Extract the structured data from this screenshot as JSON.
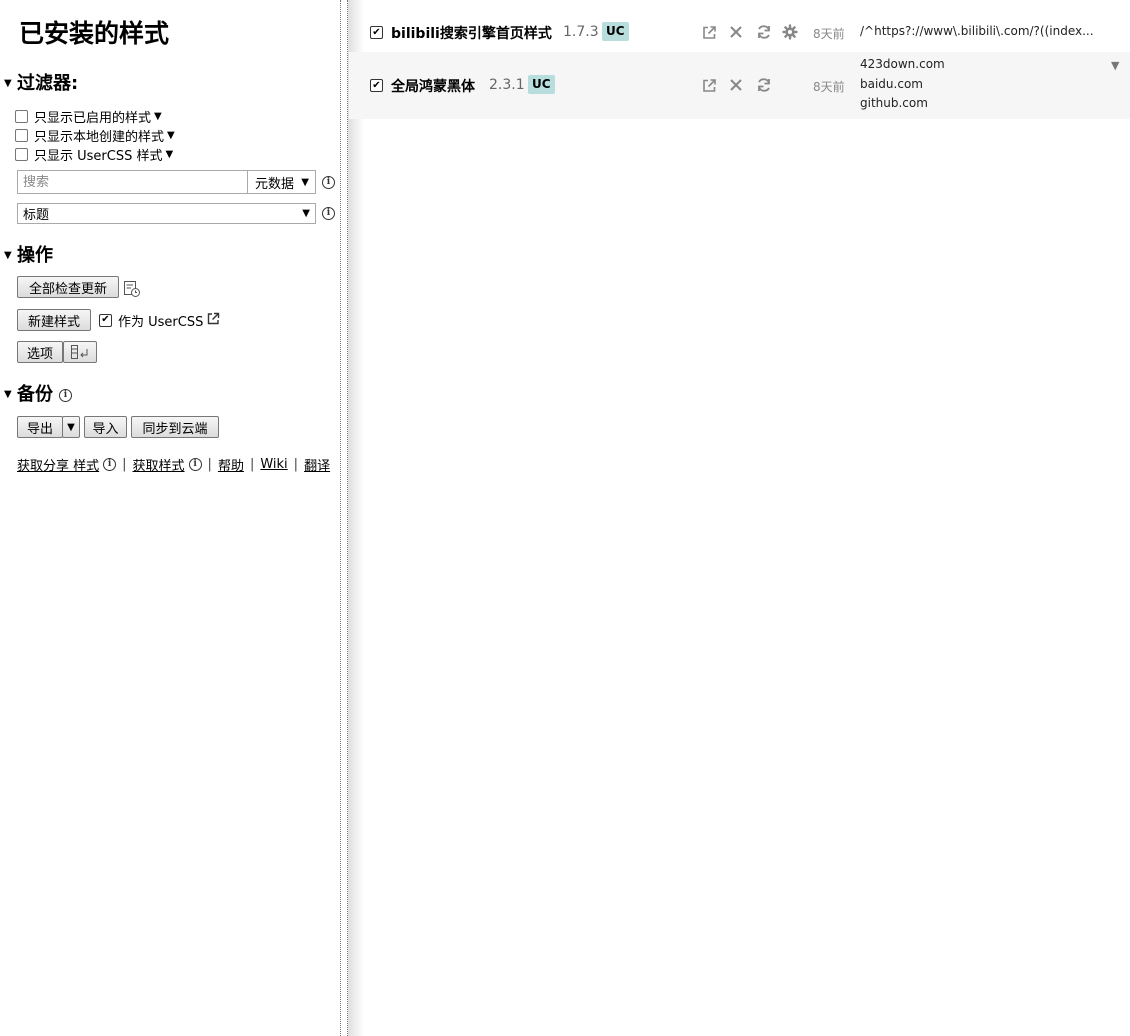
{
  "sidebar": {
    "title": "已安装的样式",
    "filters": {
      "heading": "过滤器:",
      "enabled_only": "只显示已启用的样式",
      "local_only": "只显示本地创建的样式",
      "usercss_only": "只显示 UserCSS 样式",
      "search_placeholder": "搜索",
      "search_value": "",
      "search_mode": "元数据",
      "sort_value": "标题"
    },
    "actions": {
      "heading": "操作",
      "check_all_updates": "全部检查更新",
      "new_style": "新建样式",
      "as_usercss": "作为 UserCSS",
      "options": "选项"
    },
    "backup": {
      "heading": "备份",
      "export": "导出",
      "import": "导入",
      "sync": "同步到云端"
    },
    "links": {
      "get_shared": "获取分享 样式",
      "get_styles": "获取样式",
      "help": "帮助",
      "wiki": "Wiki",
      "translate": "翻译"
    }
  },
  "styles": [
    {
      "name": "bilibili搜索引擎首页样式",
      "version": "1.7.3",
      "badge": "UC",
      "age": "8天前",
      "applies_to": [
        "/^https?://www\\.bilibili\\.com/?((index..."
      ]
    },
    {
      "name": "全局鸿蒙黑体",
      "version": "2.3.1",
      "badge": "UC",
      "age": "8天前",
      "applies_to": [
        "423down.com",
        "baidu.com",
        "github.com"
      ]
    }
  ]
}
